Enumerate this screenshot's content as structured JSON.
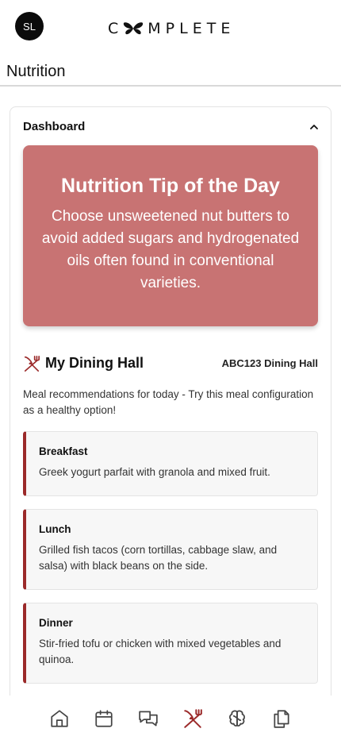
{
  "header": {
    "avatar_initials": "SL",
    "logo_text_left": "C",
    "logo_text_right": "MPLETE"
  },
  "page": {
    "title": "Nutrition"
  },
  "dashboard": {
    "title": "Dashboard",
    "collapse_icon": "chevron-up-icon",
    "tip": {
      "title": "Nutrition Tip of the Day",
      "body": "Choose unsweetened nut butters to avoid added sugars and hydrogenated oils often found in conventional varieties.",
      "color": "#c87373"
    },
    "dining": {
      "icon": "utensils-crossed-icon",
      "title": "My Dining Hall",
      "hall_name": "ABC123 Dining Hall",
      "description": "Meal recommendations for today - Try this meal configuration as a healthy option!",
      "accent_color": "#9b2a2a",
      "meals": [
        {
          "name": "Breakfast",
          "description": "Greek yogurt parfait with granola and mixed fruit."
        },
        {
          "name": "Lunch",
          "description": "Grilled fish tacos (corn tortillas, cabbage slaw, and salsa) with black beans on the side."
        },
        {
          "name": "Dinner",
          "description": "Stir-fried tofu or chicken with mixed vegetables and quinoa."
        }
      ]
    }
  },
  "bottom_nav": {
    "items": [
      {
        "icon": "home-icon",
        "active": false
      },
      {
        "icon": "calendar-icon",
        "active": false
      },
      {
        "icon": "chat-icon",
        "active": false
      },
      {
        "icon": "utensils-crossed-icon",
        "active": true
      },
      {
        "icon": "brain-icon",
        "active": false
      },
      {
        "icon": "documents-icon",
        "active": false
      }
    ],
    "active_color": "#9b2a2a",
    "inactive_color": "#444444"
  }
}
